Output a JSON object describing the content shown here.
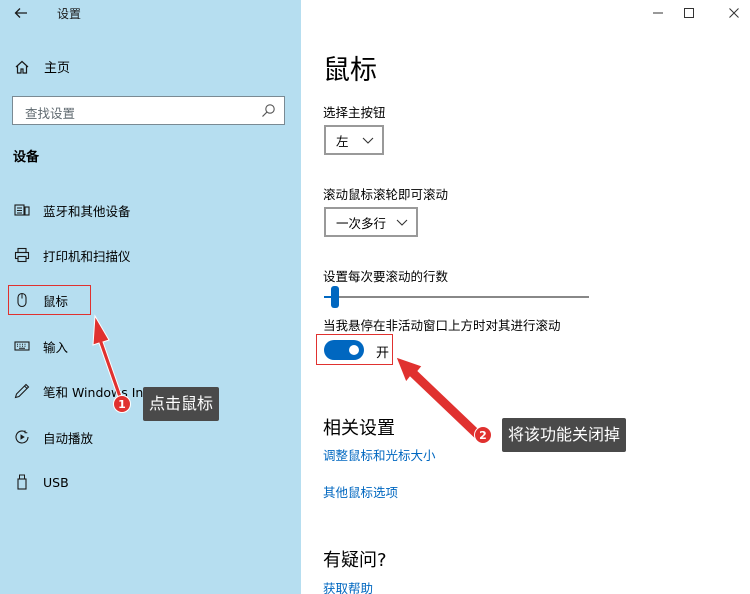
{
  "window": {
    "title": "设置",
    "back_icon": "arrow-left-icon",
    "controls": [
      "minimize-icon",
      "maximize-icon",
      "close-icon"
    ]
  },
  "sidebar": {
    "home_label": "主页",
    "search_placeholder": "查找设置",
    "section_title": "设备",
    "items": [
      {
        "label": "蓝牙和其他设备",
        "icon": "bluetooth-devices-icon"
      },
      {
        "label": "打印机和扫描仪",
        "icon": "printer-icon"
      },
      {
        "label": "鼠标",
        "icon": "mouse-icon",
        "selected": true
      },
      {
        "label": "输入",
        "icon": "keyboard-icon"
      },
      {
        "label": "笔和 Windows Ink",
        "icon": "pen-icon"
      },
      {
        "label": "自动播放",
        "icon": "autoplay-icon"
      },
      {
        "label": "USB",
        "icon": "usb-icon"
      }
    ]
  },
  "main": {
    "title": "鼠标",
    "primary_button": {
      "label": "选择主按钮",
      "value": "左"
    },
    "scroll": {
      "label": "滚动鼠标滚轮即可滚动",
      "value": "一次多行"
    },
    "lines": {
      "label": "设置每次要滚动的行数",
      "fraction": 0.02
    },
    "inactive_scroll": {
      "label": "当我悬停在非活动窗口上方时对其进行滚动",
      "state": "开",
      "on": true
    },
    "related": {
      "title": "相关设置",
      "links": [
        "调整鼠标和光标大小",
        "其他鼠标选项"
      ]
    },
    "help": {
      "title": "有疑问?",
      "link": "获取帮助"
    }
  },
  "annotations": [
    {
      "number": "1",
      "text": "点击鼠标"
    },
    {
      "number": "2",
      "text": "将该功能关闭掉"
    }
  ],
  "colors": {
    "sidebar_bg": "#b6def0",
    "accent": "#0067c0",
    "annotation_red": "#e0312f",
    "tooltip_bg": "#4a4a4a"
  }
}
